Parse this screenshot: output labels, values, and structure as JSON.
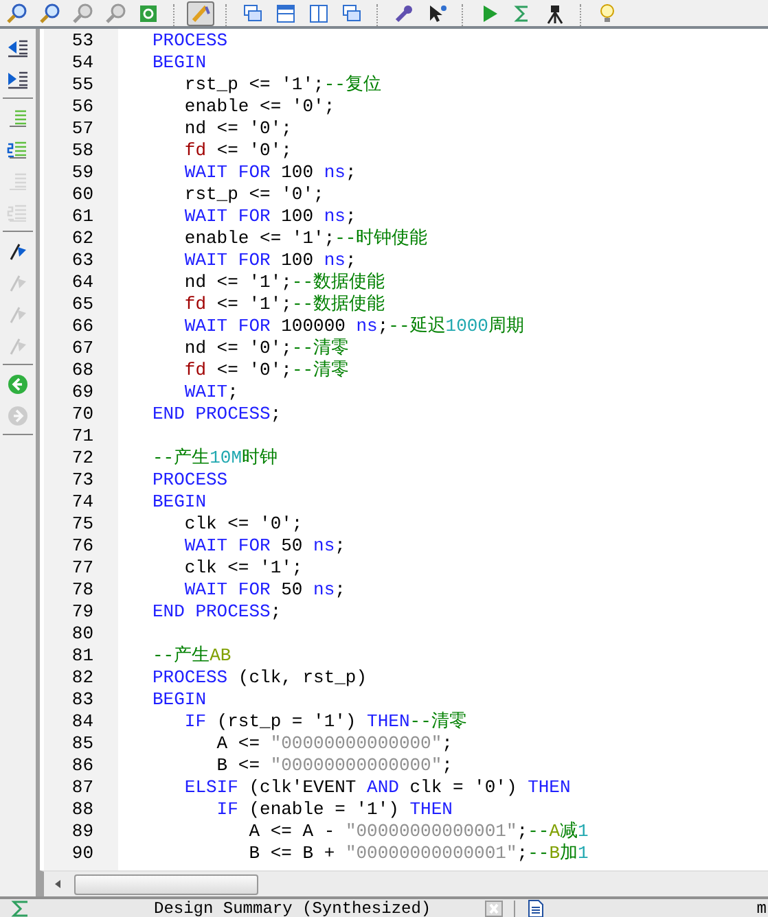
{
  "toolbar": [
    {
      "kind": "zoom",
      "selected": false
    },
    {
      "kind": "zoom-people",
      "selected": false
    },
    {
      "kind": "zoom-grey",
      "selected": false
    },
    {
      "kind": "zoom-grey",
      "selected": false
    },
    {
      "kind": "refresh",
      "selected": false
    },
    {
      "kind": "separator"
    },
    {
      "kind": "pen",
      "selected": true
    },
    {
      "kind": "separator"
    },
    {
      "kind": "windows",
      "selected": false
    },
    {
      "kind": "window-h",
      "selected": false
    },
    {
      "kind": "window-v",
      "selected": false
    },
    {
      "kind": "window-stack",
      "selected": false
    },
    {
      "kind": "separator"
    },
    {
      "kind": "wrench",
      "selected": false
    },
    {
      "kind": "help-cursor",
      "selected": false
    },
    {
      "kind": "separator"
    },
    {
      "kind": "play",
      "selected": false
    },
    {
      "kind": "sigma",
      "selected": false
    },
    {
      "kind": "tripod",
      "selected": false
    },
    {
      "kind": "separator"
    },
    {
      "kind": "bulb",
      "selected": false
    }
  ],
  "side_toolbar": [
    {
      "kind": "outdent",
      "disabled": false
    },
    {
      "kind": "indent",
      "disabled": false
    },
    {
      "kind": "separator"
    },
    {
      "kind": "comment",
      "disabled": false
    },
    {
      "kind": "comment-5",
      "disabled": false
    },
    {
      "kind": "comment",
      "disabled": true
    },
    {
      "kind": "comment-5",
      "disabled": true
    },
    {
      "kind": "separator"
    },
    {
      "kind": "flag",
      "disabled": false
    },
    {
      "kind": "flag-x",
      "disabled": true
    },
    {
      "kind": "flag-x",
      "disabled": true
    },
    {
      "kind": "flag-x",
      "disabled": true
    },
    {
      "kind": "separator"
    },
    {
      "kind": "back",
      "disabled": false
    },
    {
      "kind": "forward",
      "disabled": true
    },
    {
      "kind": "separator"
    }
  ],
  "editor": {
    "lines": [
      {
        "n": "53",
        "tokens": [
          {
            "kind": "kw",
            "text": "PROCESS"
          }
        ]
      },
      {
        "n": "54",
        "tokens": [
          {
            "kind": "kw",
            "text": "BEGIN"
          }
        ]
      },
      {
        "n": "55",
        "tokens": [
          {
            "kind": "text",
            "text": "   rst_p <= '1';"
          },
          {
            "kind": "comment",
            "text": "--复位"
          }
        ]
      },
      {
        "n": "56",
        "tokens": [
          {
            "kind": "text",
            "text": "   enable <= '0';"
          }
        ]
      },
      {
        "n": "57",
        "tokens": [
          {
            "kind": "text",
            "text": "   nd <= '0';"
          }
        ]
      },
      {
        "n": "58",
        "tokens": [
          {
            "kind": "signal",
            "text": "   fd"
          },
          {
            "kind": "text",
            "text": " <= '0';"
          }
        ]
      },
      {
        "n": "59",
        "tokens": [
          {
            "kind": "kw",
            "text": "   WAIT FOR"
          },
          {
            "kind": "text",
            "text": " 100 "
          },
          {
            "kind": "kw",
            "text": "ns"
          },
          {
            "kind": "text",
            "text": ";"
          }
        ]
      },
      {
        "n": "60",
        "tokens": [
          {
            "kind": "text",
            "text": "   rst_p <= '0';"
          }
        ]
      },
      {
        "n": "61",
        "tokens": [
          {
            "kind": "kw",
            "text": "   WAIT FOR"
          },
          {
            "kind": "text",
            "text": " 100 "
          },
          {
            "kind": "kw",
            "text": "ns"
          },
          {
            "kind": "text",
            "text": ";"
          }
        ]
      },
      {
        "n": "62",
        "tokens": [
          {
            "kind": "text",
            "text": "   enable <= '1';"
          },
          {
            "kind": "comment",
            "text": "--时钟使能"
          }
        ]
      },
      {
        "n": "63",
        "tokens": [
          {
            "kind": "kw",
            "text": "   WAIT FOR"
          },
          {
            "kind": "text",
            "text": " 100 "
          },
          {
            "kind": "kw",
            "text": "ns"
          },
          {
            "kind": "text",
            "text": ";"
          }
        ]
      },
      {
        "n": "64",
        "tokens": [
          {
            "kind": "text",
            "text": "   nd <= '1';"
          },
          {
            "kind": "comment",
            "text": "--数据使能"
          }
        ]
      },
      {
        "n": "65",
        "tokens": [
          {
            "kind": "signal",
            "text": "   fd"
          },
          {
            "kind": "text",
            "text": " <= '1';"
          },
          {
            "kind": "comment",
            "text": "--数据使能"
          }
        ]
      },
      {
        "n": "66",
        "tokens": [
          {
            "kind": "kw",
            "text": "   WAIT FOR"
          },
          {
            "kind": "text",
            "text": " 100000 "
          },
          {
            "kind": "kw",
            "text": "ns"
          },
          {
            "kind": "text",
            "text": ";"
          },
          {
            "kind": "comment",
            "text": "--延迟"
          },
          {
            "kind": "number",
            "text": "1000"
          },
          {
            "kind": "comment",
            "text": "周期"
          }
        ]
      },
      {
        "n": "67",
        "tokens": [
          {
            "kind": "text",
            "text": "   nd <= '0';"
          },
          {
            "kind": "comment",
            "text": "--清零"
          }
        ]
      },
      {
        "n": "68",
        "tokens": [
          {
            "kind": "signal",
            "text": "   fd"
          },
          {
            "kind": "text",
            "text": " <= '0';"
          },
          {
            "kind": "comment",
            "text": "--清零"
          }
        ]
      },
      {
        "n": "69",
        "tokens": [
          {
            "kind": "kw",
            "text": "   WAIT"
          },
          {
            "kind": "text",
            "text": ";"
          }
        ]
      },
      {
        "n": "70",
        "tokens": [
          {
            "kind": "kw",
            "text": "END PROCESS"
          },
          {
            "kind": "text",
            "text": ";"
          }
        ]
      },
      {
        "n": "71"
      },
      {
        "n": "72",
        "tokens": [
          {
            "kind": "comment",
            "text": "--产生"
          },
          {
            "kind": "number",
            "text": "10M"
          },
          {
            "kind": "comment",
            "text": "时钟"
          }
        ]
      },
      {
        "n": "73",
        "tokens": [
          {
            "kind": "kw",
            "text": "PROCESS"
          }
        ]
      },
      {
        "n": "74",
        "tokens": [
          {
            "kind": "kw",
            "text": "BEGIN"
          }
        ]
      },
      {
        "n": "75",
        "tokens": [
          {
            "kind": "text",
            "text": "   clk <= '0';"
          }
        ]
      },
      {
        "n": "76",
        "tokens": [
          {
            "kind": "kw",
            "text": "   WAIT FOR"
          },
          {
            "kind": "text",
            "text": " 50 "
          },
          {
            "kind": "kw",
            "text": "ns"
          },
          {
            "kind": "text",
            "text": ";"
          }
        ]
      },
      {
        "n": "77",
        "tokens": [
          {
            "kind": "text",
            "text": "   clk <= '1';"
          }
        ]
      },
      {
        "n": "78",
        "tokens": [
          {
            "kind": "kw",
            "text": "   WAIT FOR"
          },
          {
            "kind": "text",
            "text": " 50 "
          },
          {
            "kind": "kw",
            "text": "ns"
          },
          {
            "kind": "text",
            "text": ";"
          }
        ]
      },
      {
        "n": "79",
        "tokens": [
          {
            "kind": "kw",
            "text": "END PROCESS"
          },
          {
            "kind": "text",
            "text": ";"
          }
        ]
      },
      {
        "n": "80"
      },
      {
        "n": "81",
        "tokens": [
          {
            "kind": "comment",
            "text": "--产生"
          },
          {
            "kind": "word",
            "text": "AB"
          }
        ]
      },
      {
        "n": "82",
        "tokens": [
          {
            "kind": "kw",
            "text": "PROCESS"
          },
          {
            "kind": "text",
            "text": " (clk, rst_p)"
          }
        ]
      },
      {
        "n": "83",
        "tokens": [
          {
            "kind": "kw",
            "text": "BEGIN"
          }
        ]
      },
      {
        "n": "84",
        "tokens": [
          {
            "kind": "kw",
            "text": "   IF"
          },
          {
            "kind": "text",
            "text": " (rst_p = '1') "
          },
          {
            "kind": "kw",
            "text": "THEN"
          },
          {
            "kind": "comment",
            "text": "--清零"
          }
        ]
      },
      {
        "n": "85",
        "tokens": [
          {
            "kind": "text",
            "text": "      A <= "
          },
          {
            "kind": "string",
            "text": "\"00000000000000\""
          },
          {
            "kind": "text",
            "text": ";"
          }
        ]
      },
      {
        "n": "86",
        "tokens": [
          {
            "kind": "text",
            "text": "      B <= "
          },
          {
            "kind": "string",
            "text": "\"00000000000000\""
          },
          {
            "kind": "text",
            "text": ";"
          }
        ]
      },
      {
        "n": "87",
        "tokens": [
          {
            "kind": "kw",
            "text": "   ELSIF"
          },
          {
            "kind": "text",
            "text": " (clk'EVENT "
          },
          {
            "kind": "kw",
            "text": "AND"
          },
          {
            "kind": "text",
            "text": " clk = '0') "
          },
          {
            "kind": "kw",
            "text": "THEN"
          }
        ]
      },
      {
        "n": "88",
        "tokens": [
          {
            "kind": "kw",
            "text": "      IF"
          },
          {
            "kind": "text",
            "text": " (enable = '1') "
          },
          {
            "kind": "kw",
            "text": "THEN"
          }
        ]
      },
      {
        "n": "89",
        "tokens": [
          {
            "kind": "text",
            "text": "         A <= A - "
          },
          {
            "kind": "string",
            "text": "\"00000000000001\""
          },
          {
            "kind": "text",
            "text": ";"
          },
          {
            "kind": "comment",
            "text": "--"
          },
          {
            "kind": "word",
            "text": "A"
          },
          {
            "kind": "comment",
            "text": "减"
          },
          {
            "kind": "number",
            "text": "1"
          }
        ]
      },
      {
        "n": "90",
        "tokens": [
          {
            "kind": "text",
            "text": "         B <= B + "
          },
          {
            "kind": "string",
            "text": "\"00000000000001\""
          },
          {
            "kind": "text",
            "text": ";"
          },
          {
            "kind": "comment",
            "text": "--"
          },
          {
            "kind": "word",
            "text": "B"
          },
          {
            "kind": "comment",
            "text": "加"
          },
          {
            "kind": "number",
            "text": "1"
          }
        ]
      }
    ]
  },
  "bottom_tabs": [
    {
      "label": "Design Summary (Synthesized)"
    },
    {
      "label": "m"
    }
  ]
}
